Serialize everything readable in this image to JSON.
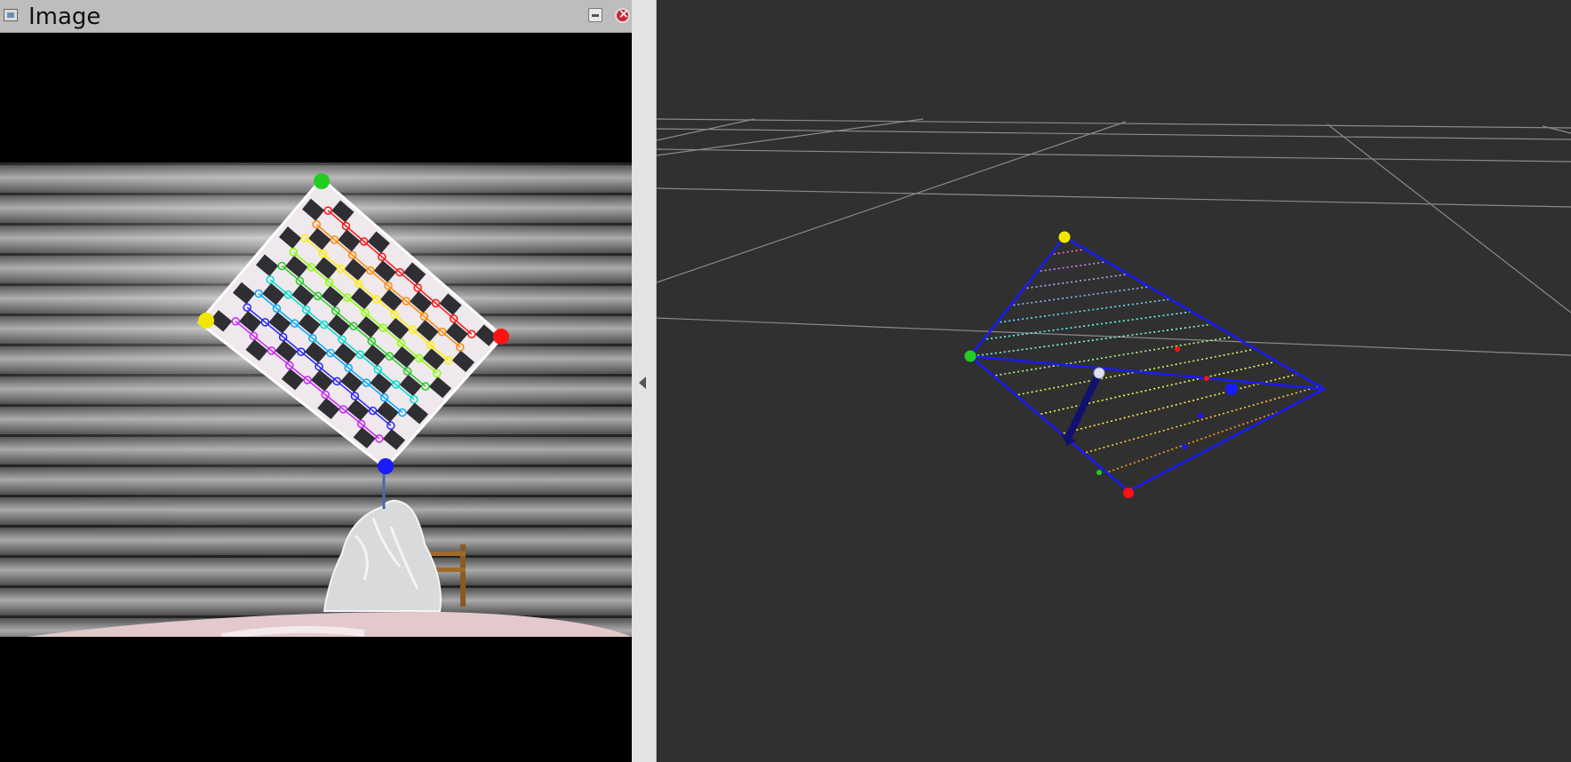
{
  "window": {
    "title": "Image",
    "icons": {
      "app": "image-icon",
      "minimize": "minimize-icon",
      "close": "close-icon"
    }
  },
  "splitter": {
    "icon": "chevron-left-icon"
  },
  "colors": {
    "titlebar": "#bdbdbd",
    "image_background": "#000000",
    "viewer_background": "#303030",
    "grid": "#8a8a8a",
    "marker_green": "#22cc22",
    "marker_yellow": "#f2e600",
    "marker_red": "#ff1111",
    "marker_blue": "#1a1aff",
    "board_outline": "#1a1aff"
  }
}
